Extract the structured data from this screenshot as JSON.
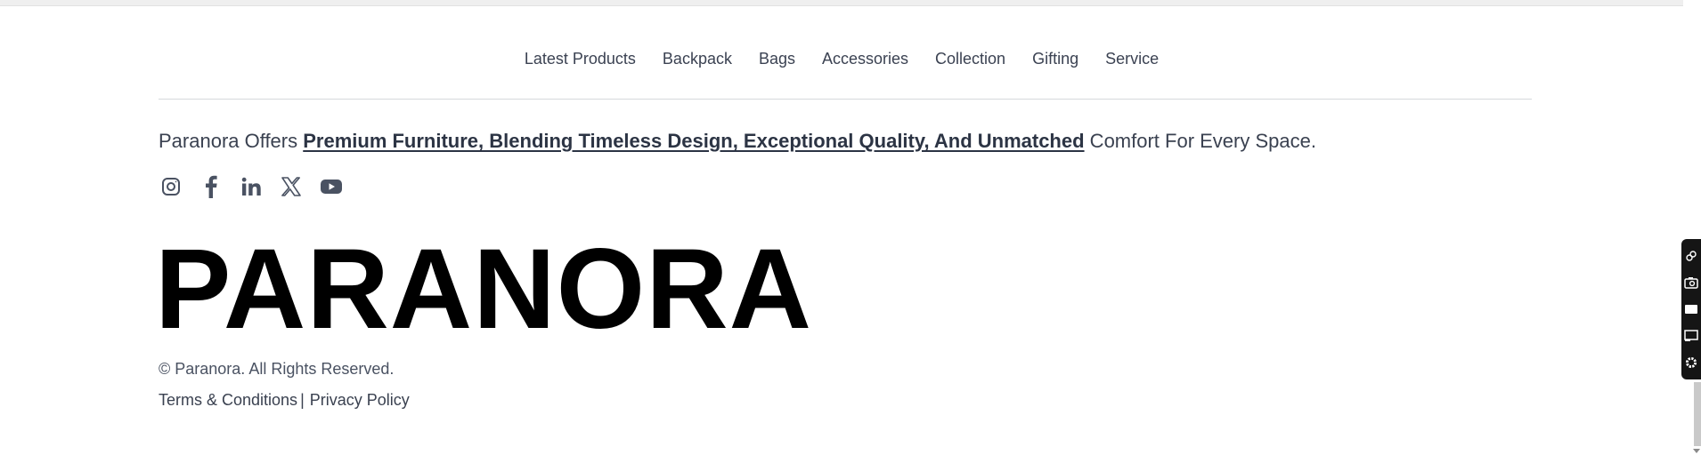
{
  "nav": {
    "items": [
      {
        "label": "Latest Products"
      },
      {
        "label": "Backpack"
      },
      {
        "label": "Bags"
      },
      {
        "label": "Accessories"
      },
      {
        "label": "Collection"
      },
      {
        "label": "Gifting"
      },
      {
        "label": "Service"
      }
    ]
  },
  "tagline": {
    "prefix": "Paranora Offers ",
    "highlight": "Premium Furniture, Blending Timeless Design, Exceptional Quality, And Unmatched",
    "suffix": " Comfort For Every Space."
  },
  "social": {
    "icons": [
      "instagram-icon",
      "facebook-icon",
      "linkedin-icon",
      "x-icon",
      "youtube-icon"
    ]
  },
  "brand": {
    "wordmark": "PARANORA"
  },
  "footer": {
    "copyright": "© Paranora. All Rights Reserved.",
    "terms_label": "Terms & Conditions",
    "separator": "|",
    "privacy_label": "Privacy Policy"
  },
  "colors": {
    "text": "#3a4150",
    "brand": "#000000",
    "divider": "#d6d8dc",
    "toolbar": "#151515"
  }
}
